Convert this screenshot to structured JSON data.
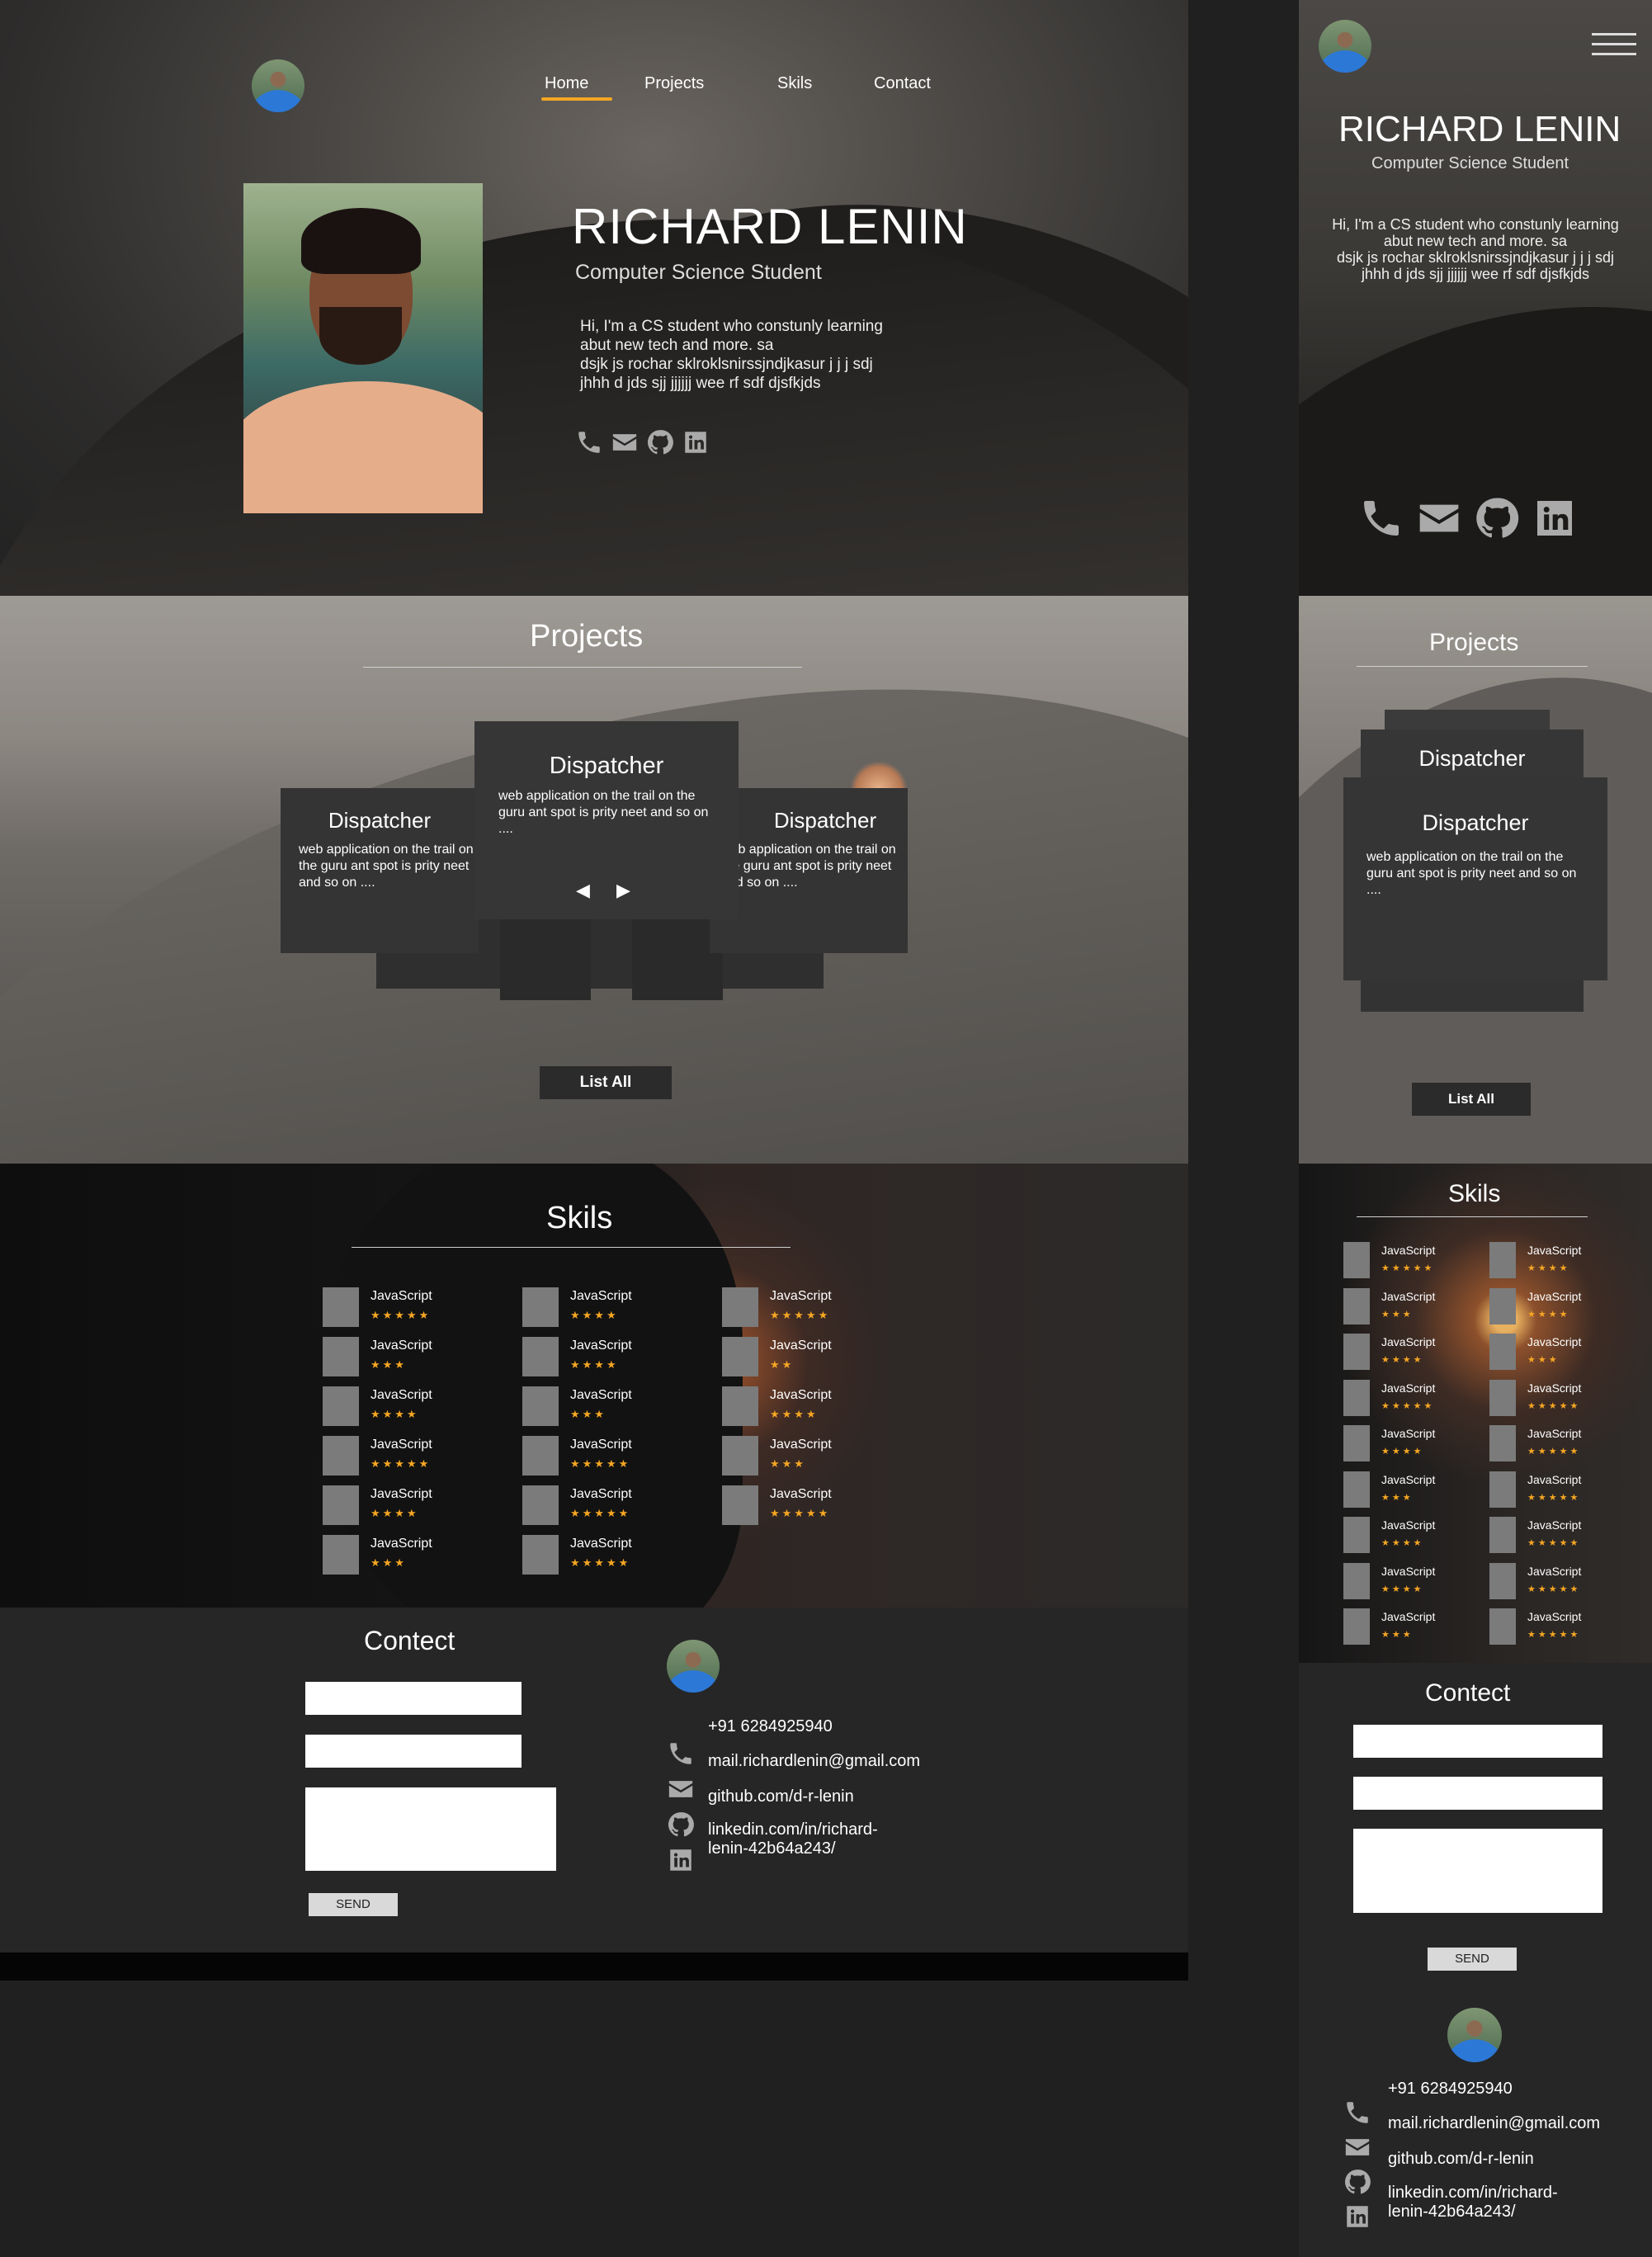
{
  "nav": {
    "home": "Home",
    "projects": "Projects",
    "skills": "Skils",
    "contact": "Contact"
  },
  "profile": {
    "name": "RICHARD LENIN",
    "title": "Computer Science Student",
    "bio": "Hi, I'm a CS student who constunly learning\nabut new tech and more.  sa\ndsjk js  rochar sklroklsnirssjndjkasur   j j j sdj\njhhh d jds sjj      jjjjjj     wee rf    sdf djsfkjds",
    "bio_mobile": "Hi, I'm a CS student who constunly learning\nabut new tech and more.  sa\ndsjk js  rochar sklroklsnirssjndjkasur   j j j sdj\njhhh d jds sjj      jjjjjj     wee rf    sdf djsfkjds"
  },
  "social_icons": [
    "phone-icon",
    "mail-icon",
    "github-icon",
    "linkedin-icon"
  ],
  "projects": {
    "title": "Projects",
    "cards": [
      {
        "name": "Dispatcher",
        "desc": "web application on the trail on the guru ant spot is prity neet and so on ...."
      },
      {
        "name": "Dispatcher",
        "desc": "web application on the trail on the guru ant spot is prity neet and so on ...."
      },
      {
        "name": "Dispatcher",
        "desc": "web application on the trail on the guru ant spot is prity neet and so on ...."
      }
    ],
    "left_card_desc": "web application on the trail on the guru ant spot is prity neet and so on ....",
    "right_card_desc": "web application on the trail on the guru ant spot is prity neet and so on ....",
    "prev": "◀",
    "next": "▶",
    "list_all": "List All"
  },
  "skills": {
    "title": "Skils",
    "columns": [
      [
        {
          "name": "JavaScript",
          "stars": "★★★★★"
        },
        {
          "name": "JavaScript",
          "stars": "★★★"
        },
        {
          "name": "JavaScript",
          "stars": "★★★★"
        },
        {
          "name": "JavaScript",
          "stars": "★★★★★"
        },
        {
          "name": "JavaScript",
          "stars": "★★★★"
        },
        {
          "name": "JavaScript",
          "stars": "★★★"
        }
      ],
      [
        {
          "name": "JavaScript",
          "stars": "★★★★"
        },
        {
          "name": "JavaScript",
          "stars": "★★★★"
        },
        {
          "name": "JavaScript",
          "stars": "★★★"
        },
        {
          "name": "JavaScript",
          "stars": "★★★★★"
        },
        {
          "name": "JavaScript",
          "stars": "★★★★★"
        },
        {
          "name": "JavaScript",
          "stars": "★★★★★"
        }
      ],
      [
        {
          "name": "JavaScript",
          "stars": "★★★★★"
        },
        {
          "name": "JavaScript",
          "stars": "★★"
        },
        {
          "name": "JavaScript",
          "stars": "★★★★"
        },
        {
          "name": "JavaScript",
          "stars": "★★★"
        },
        {
          "name": "JavaScript",
          "stars": "★★★★★"
        }
      ]
    ],
    "mobile_columns": [
      [
        {
          "name": "JavaScript",
          "stars": "★★★★★"
        },
        {
          "name": "JavaScript",
          "stars": "★★★"
        },
        {
          "name": "JavaScript",
          "stars": "★★★★"
        },
        {
          "name": "JavaScript",
          "stars": "★★★★★"
        },
        {
          "name": "JavaScript",
          "stars": "★★★★"
        },
        {
          "name": "JavaScript",
          "stars": "★★★"
        },
        {
          "name": "JavaScript",
          "stars": "★★★★"
        },
        {
          "name": "JavaScript",
          "stars": "★★★★"
        },
        {
          "name": "JavaScript",
          "stars": "★★★"
        }
      ],
      [
        {
          "name": "JavaScript",
          "stars": "★★★★"
        },
        {
          "name": "JavaScript",
          "stars": "★★★★"
        },
        {
          "name": "JavaScript",
          "stars": "★★★"
        },
        {
          "name": "JavaScript",
          "stars": "★★★★★"
        },
        {
          "name": "JavaScript",
          "stars": "★★★★★"
        },
        {
          "name": "JavaScript",
          "stars": "★★★★★"
        },
        {
          "name": "JavaScript",
          "stars": "★★★★★"
        },
        {
          "name": "JavaScript",
          "stars": "★★★★★"
        },
        {
          "name": "JavaScript",
          "stars": "★★★★★"
        }
      ]
    ]
  },
  "contact": {
    "title": "Contect",
    "send": "SEND",
    "phone": "+91 6284925940",
    "email": "mail.richardlenin@gmail.com",
    "github": "github.com/d-r-lenin",
    "linkedin_1": "linkedin.com/in/richard-",
    "linkedin_2": "lenin-42b64a243/"
  },
  "colors": {
    "accent": "#f5a623",
    "card": "#343434",
    "page": "#272727"
  }
}
